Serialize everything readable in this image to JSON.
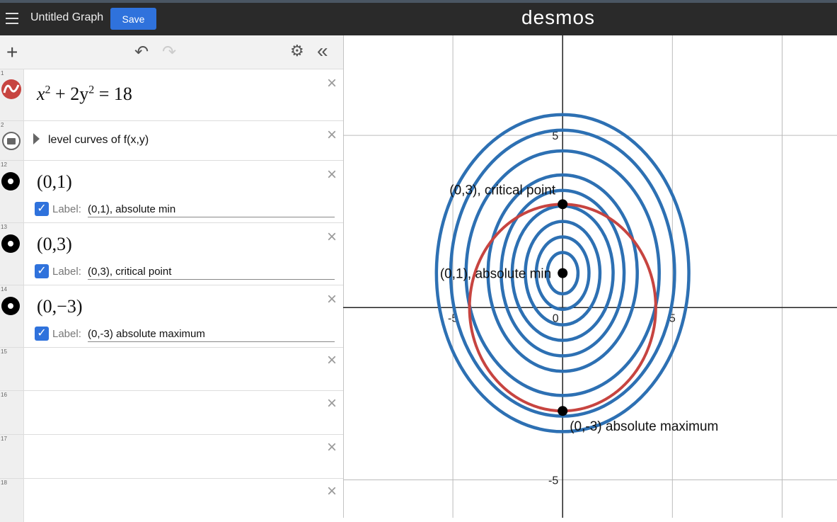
{
  "topbar": {
    "title": "Untitled Graph",
    "save_label": "Save",
    "brand": "desmos"
  },
  "toolbar": {
    "add": "+",
    "undo": "↶",
    "redo": "↷",
    "settings": "⚙",
    "collapse": "«"
  },
  "expressions": [
    {
      "num": "1",
      "latex_base": "x",
      "latex_exp": "2",
      "latex_mid": " + 2y",
      "latex_exp2": "2",
      "latex_end": " = 18"
    },
    {
      "num": "2",
      "folder_label": "level curves of f(x,y)"
    },
    {
      "num": "12",
      "point": "(0,1)",
      "label_word": "Label:",
      "label": "(0,1), absolute min"
    },
    {
      "num": "13",
      "point": "(0,3)",
      "label_word": "Label:",
      "label": "(0,3), critical point"
    },
    {
      "num": "14",
      "point": "(0,−3)",
      "label_word": "Label:",
      "label": "(0,-3) absolute maximum"
    },
    {
      "num": "15"
    },
    {
      "num": "16"
    },
    {
      "num": "17"
    },
    {
      "num": "18"
    }
  ],
  "icons": {
    "graph_icon": "curve-icon",
    "folder_icon": "folder-icon",
    "delete": "×",
    "check": "✓"
  },
  "colors": {
    "constraint": "#c74440",
    "level_curves": "#2d70b3",
    "points": "#000000",
    "save": "#2f72dc"
  },
  "graph": {
    "x_range": [
      -10,
      12.5
    ],
    "y_range": [
      -6.1,
      7.9
    ],
    "tick_labels": {
      "x": [
        "-5",
        "0",
        "5"
      ],
      "y": [
        "5",
        "-5"
      ]
    },
    "constraint_ellipse": {
      "equation": "x^2+2y^2=18",
      "x_semi_axis": 4.243,
      "y_semi_axis": 3
    },
    "level_curves": [
      {
        "center": [
          0,
          1
        ],
        "x_semi_axis": 0.7,
        "y_semi_axis": 0.6
      },
      {
        "center": [
          0,
          1
        ],
        "x_semi_axis": 1.2,
        "y_semi_axis": 1.05
      },
      {
        "center": [
          0,
          1
        ],
        "x_semi_axis": 1.7,
        "y_semi_axis": 1.5
      },
      {
        "center": [
          0,
          1
        ],
        "x_semi_axis": 2.3,
        "y_semi_axis": 1.95
      },
      {
        "center": [
          0,
          1
        ],
        "x_semi_axis": 2.8,
        "y_semi_axis": 2.4
      },
      {
        "center": [
          0,
          1
        ],
        "x_semi_axis": 3.4,
        "y_semi_axis": 2.85
      },
      {
        "center": [
          0,
          1
        ],
        "x_semi_axis": 4.4,
        "y_semi_axis": 3.55
      },
      {
        "center": [
          0,
          1
        ],
        "x_semi_axis": 5.1,
        "y_semi_axis": 4.15
      },
      {
        "center": [
          0,
          1
        ],
        "x_semi_axis": 5.75,
        "y_semi_axis": 4.6
      }
    ],
    "points": [
      {
        "x": 0,
        "y": 3,
        "label": "(0,3), critical point",
        "label_pos": "above-left"
      },
      {
        "x": 0,
        "y": 1,
        "label": "(0,1), absolute min",
        "label_pos": "left"
      },
      {
        "x": 0,
        "y": -3,
        "label": "(0,-3) absolute maximum",
        "label_pos": "below-right"
      }
    ]
  }
}
